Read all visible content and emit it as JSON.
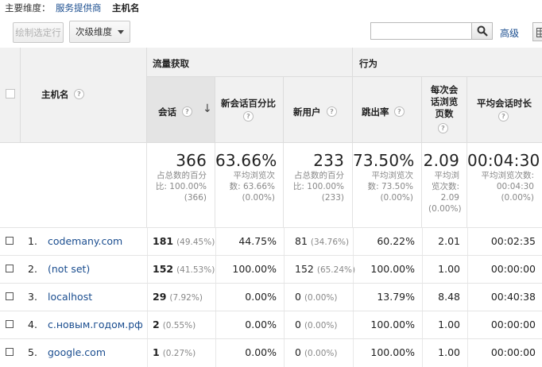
{
  "dimension_bar": {
    "label": "主要维度：",
    "link": "服务提供商",
    "current": "主机名"
  },
  "toolbar": {
    "plot_rows": "绘制选定行",
    "secondary_dimension": "次级维度",
    "search_value": "",
    "advanced": "高级"
  },
  "table": {
    "group_acquisition": "流量获取",
    "group_behavior": "行为",
    "col_hostname": "主机名",
    "columns": [
      "会话",
      "新会话百分比",
      "新用户",
      "跳出率",
      "每次会话浏览页数",
      "平均会话时长"
    ],
    "help_glyph": "?",
    "sort_glyph": "↓",
    "totals": {
      "sessions": {
        "value": "366",
        "sub1": "占总数的百分",
        "sub2": "比: 100.00%",
        "sub3": "(366)"
      },
      "new_session_pct": {
        "value": "63.66%",
        "sub1": "平均浏览次",
        "sub2": "数: 63.66%",
        "sub3": "(0.00%)"
      },
      "new_users": {
        "value": "233",
        "sub1": "占总数的百分",
        "sub2": "比: 100.00%",
        "sub3": "(233)"
      },
      "bounce_rate": {
        "value": "73.50%",
        "sub1": "平均浏览次",
        "sub2": "数: 73.50%",
        "sub3": "(0.00%)"
      },
      "pages_per_session": {
        "value": "2.09",
        "sub1": "平均浏",
        "sub2": "览次数:",
        "sub3": "2.09",
        "sub4": "(0.00%)"
      },
      "avg_duration": {
        "value": "00:04:30",
        "sub1": "平均浏览次数:",
        "sub2": "00:04:30",
        "sub3": "(0.00%)"
      }
    },
    "rows": [
      {
        "index": "1.",
        "host": "codemany.com",
        "sessions": "181",
        "sessions_pct": "(49.45%)",
        "new_pct": "44.75%",
        "new_users": "81",
        "new_users_pct": "(34.76%)",
        "bounce": "60.22%",
        "pages": "2.01",
        "duration": "00:02:35"
      },
      {
        "index": "2.",
        "host": "(not set)",
        "sessions": "152",
        "sessions_pct": "(41.53%)",
        "new_pct": "100.00%",
        "new_users": "152",
        "new_users_pct": "(65.24%)",
        "bounce": "100.00%",
        "pages": "1.00",
        "duration": "00:00:00"
      },
      {
        "index": "3.",
        "host": "localhost",
        "sessions": "29",
        "sessions_pct": "(7.92%)",
        "new_pct": "0.00%",
        "new_users": "0",
        "new_users_pct": "(0.00%)",
        "bounce": "13.79%",
        "pages": "8.48",
        "duration": "00:40:38"
      },
      {
        "index": "4.",
        "host": "с.новым.годом.рф",
        "sessions": "2",
        "sessions_pct": "(0.55%)",
        "new_pct": "0.00%",
        "new_users": "0",
        "new_users_pct": "(0.00%)",
        "bounce": "100.00%",
        "pages": "1.00",
        "duration": "00:00:00"
      },
      {
        "index": "5.",
        "host": "google.com",
        "sessions": "1",
        "sessions_pct": "(0.27%)",
        "new_pct": "0.00%",
        "new_users": "0",
        "new_users_pct": "(0.00%)",
        "bounce": "100.00%",
        "pages": "1.00",
        "duration": "00:00:00"
      }
    ]
  }
}
